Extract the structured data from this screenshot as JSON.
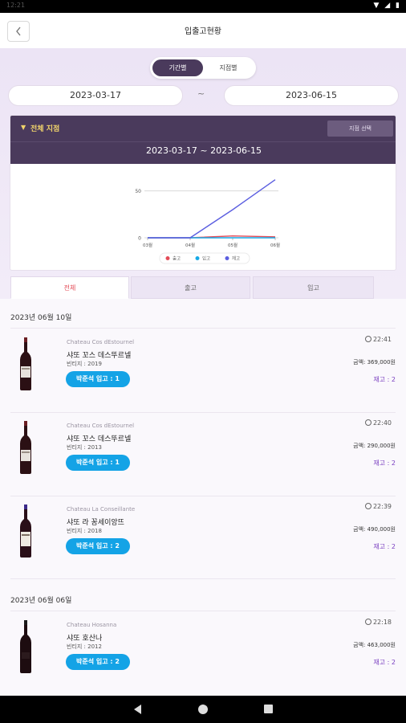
{
  "status_bar": {
    "time": "12:21",
    "icons": "▼ ◢ ▮"
  },
  "app_bar": {
    "title": "입출고현황",
    "back_icon": "chevron-left-icon"
  },
  "segment": {
    "options": [
      "기간별",
      "지점별"
    ],
    "selected": "기간별"
  },
  "date_range": {
    "start": "2023-03-17",
    "separator": "~",
    "end": "2023-06-15"
  },
  "filter_card": {
    "label": "전체 지점",
    "branch_button": "지점 선택",
    "period": "2023-03-17 ~ 2023-06-15"
  },
  "chart_data": {
    "type": "line",
    "x": [
      "03월",
      "04월",
      "05월",
      "06월"
    ],
    "ylim": [
      0,
      60
    ],
    "yticks": [
      0,
      50
    ],
    "series": [
      {
        "name": "출고",
        "color": "#e34b57",
        "values": [
          0,
          0,
          2,
          1
        ]
      },
      {
        "name": "입고",
        "color": "#16a9e6",
        "values": [
          0,
          0,
          0,
          0
        ]
      },
      {
        "name": "재고",
        "color": "#5b5ee0",
        "values": [
          0,
          0,
          30,
          62
        ]
      }
    ],
    "legend": "bottom-center",
    "grid": true
  },
  "tabs": [
    {
      "label": "전체",
      "active": true
    },
    {
      "label": "출고",
      "active": false
    },
    {
      "label": "입고",
      "active": false
    }
  ],
  "groups": [
    {
      "date": "2023년 06월 10일",
      "items": [
        {
          "brand": "Chateau Cos dEstournel",
          "name": "샤또 꼬스 데스뚜르넬",
          "vintage": "빈티지 : 2019",
          "badge": "박준석 입고 : 1",
          "time": "22:41",
          "amount": "금액: 369,000원",
          "stock": "재고 : 2"
        },
        {
          "brand": "Chateau Cos dEstournel",
          "name": "샤또 꼬스 데스뚜르넬",
          "vintage": "빈티지 : 2013",
          "badge": "박준석 입고 : 1",
          "time": "22:40",
          "amount": "금액: 290,000원",
          "stock": "재고 : 2"
        },
        {
          "brand": "Chateau La Conseillante",
          "name": "샤또 라 꽁세이앙뜨",
          "vintage": "빈티지 : 2018",
          "badge": "박준석 입고 : 2",
          "time": "22:39",
          "amount": "금액: 490,000원",
          "stock": "재고 : 2"
        }
      ]
    },
    {
      "date": "2023년 06월 06일",
      "items": [
        {
          "brand": "Chateau Hosanna",
          "name": "샤또 호산나",
          "vintage": "빈티지 : 2012",
          "badge": "박준석 입고 : 2",
          "time": "22:18",
          "amount": "금액: 463,000원",
          "stock": "재고 : 2"
        }
      ]
    }
  ]
}
